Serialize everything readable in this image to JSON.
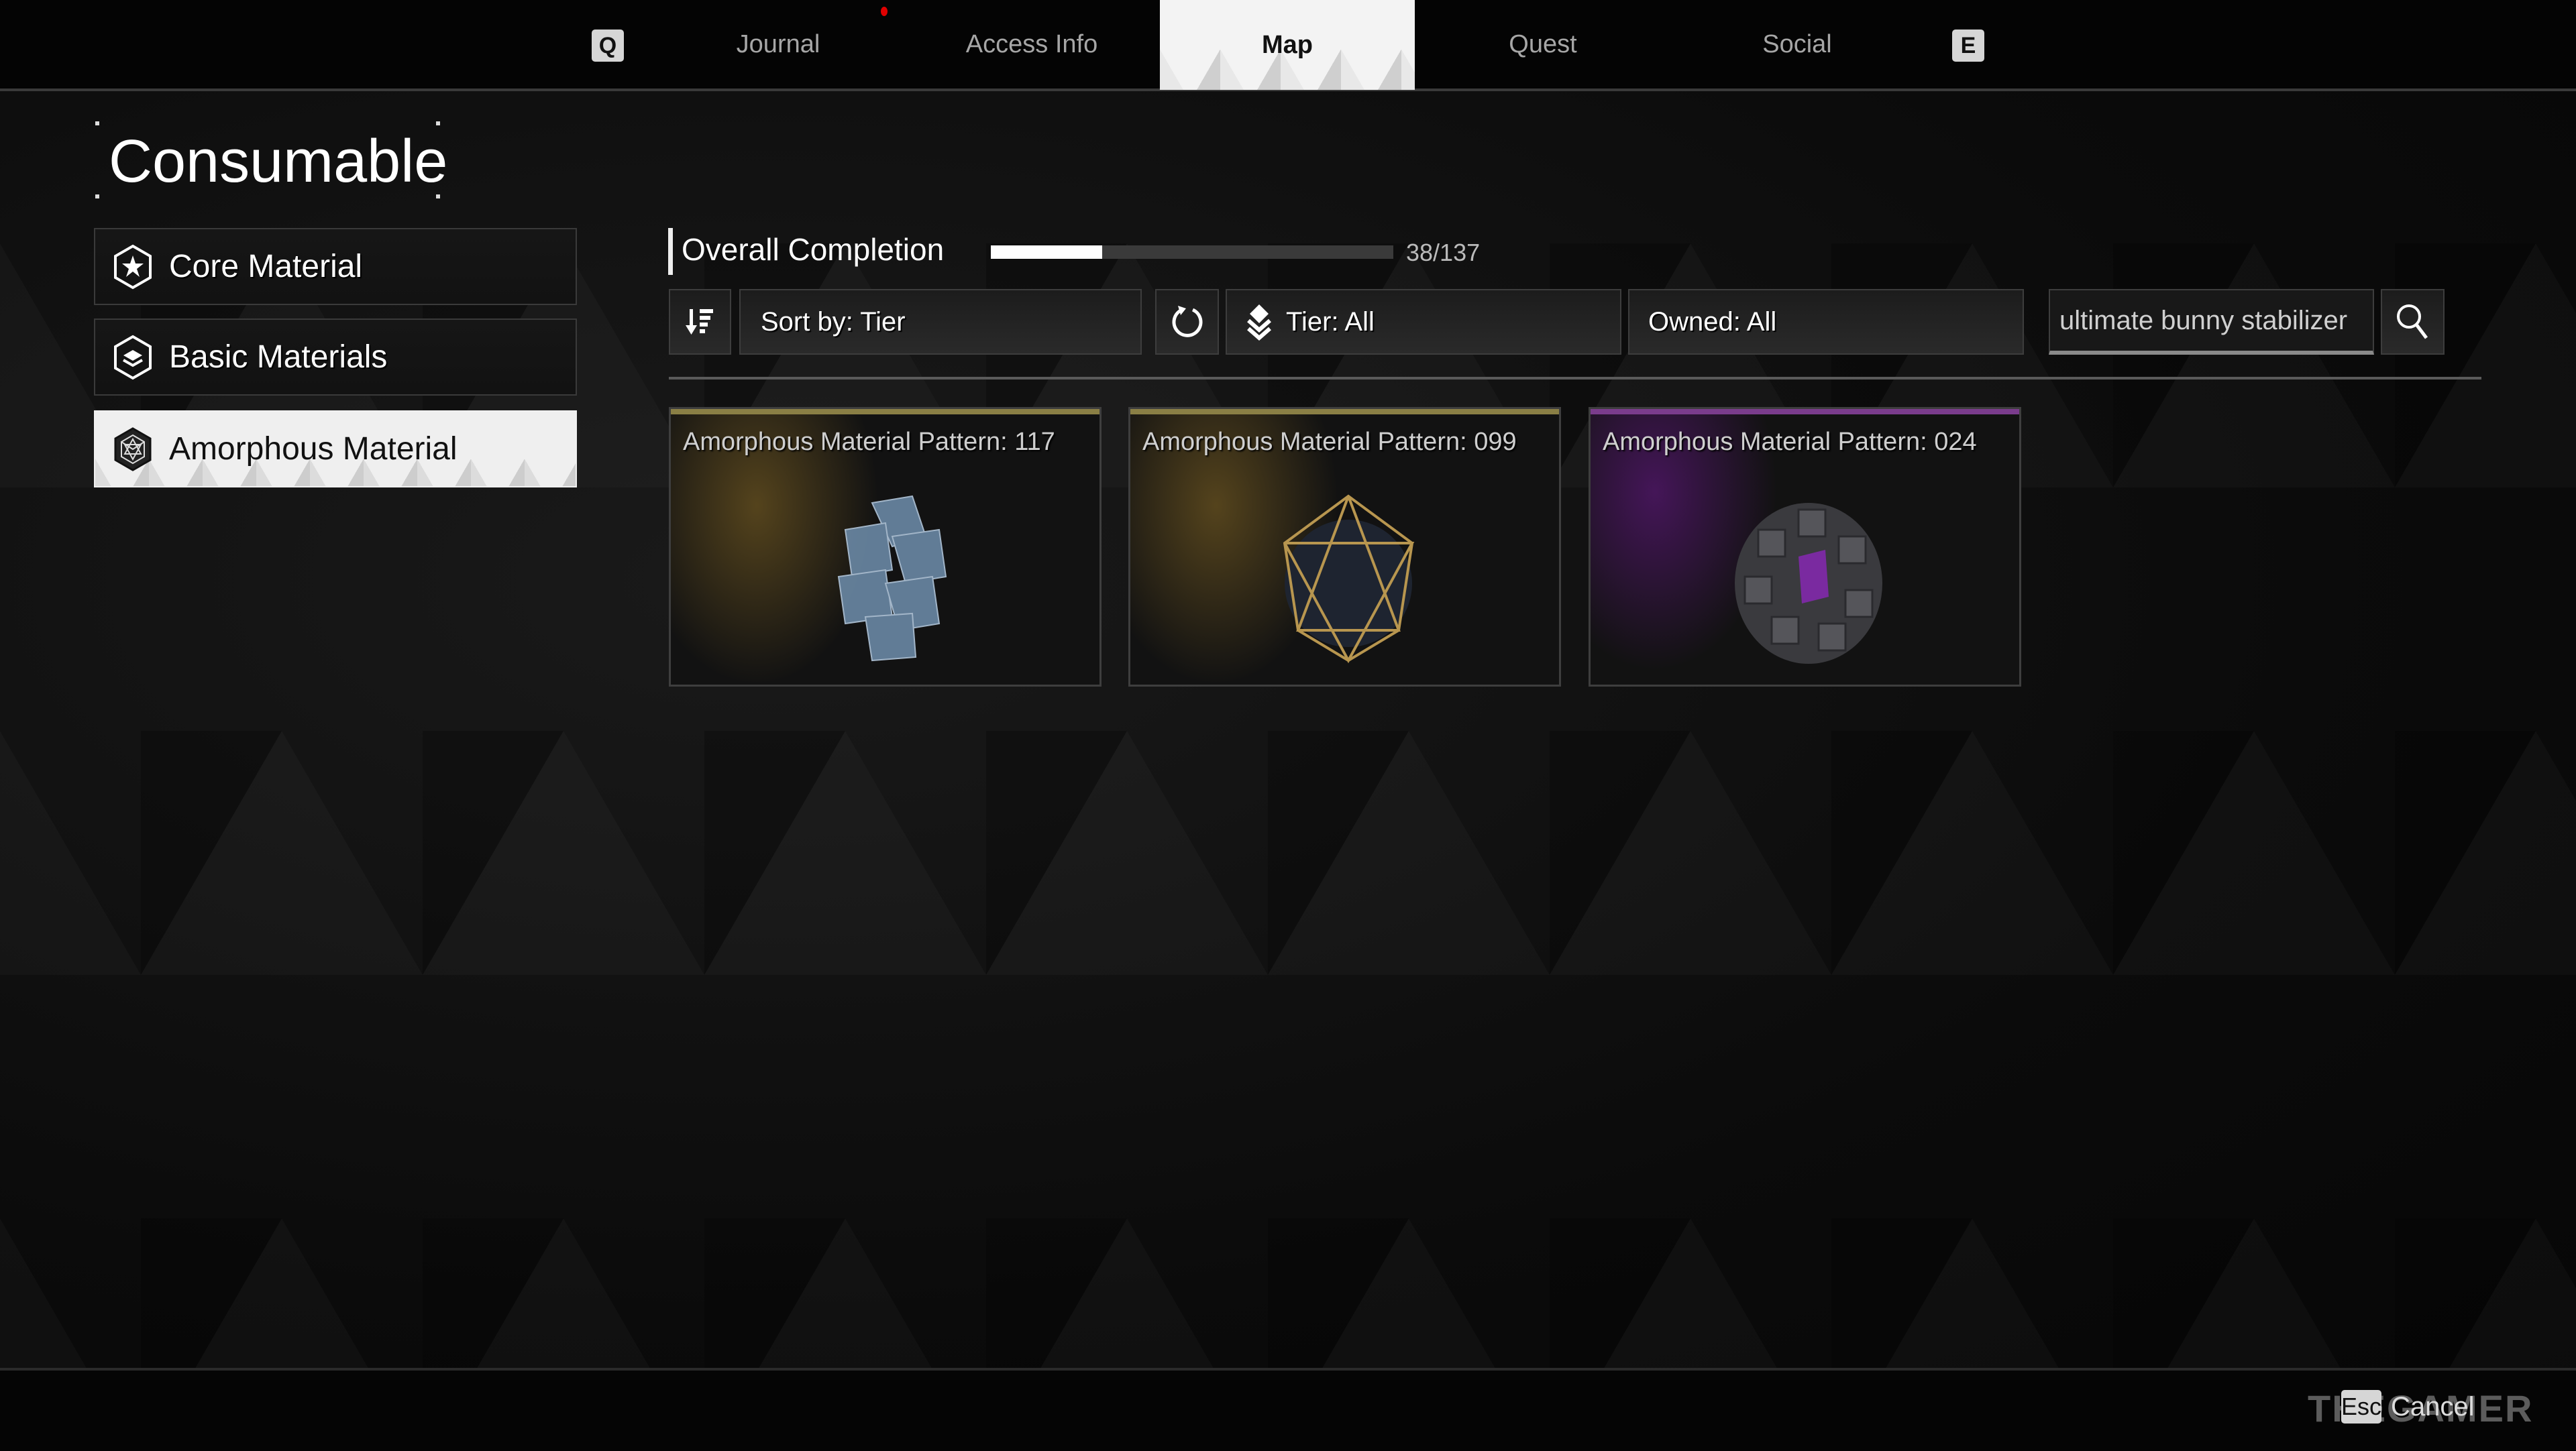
{
  "top_nav": {
    "prev_key": "Q",
    "next_key": "E",
    "tabs": [
      {
        "label": "Journal",
        "active": false,
        "notification": true
      },
      {
        "label": "Access Info",
        "active": false,
        "notification": false
      },
      {
        "label": "Map",
        "active": true,
        "notification": false
      },
      {
        "label": "Quest",
        "active": false,
        "notification": false
      },
      {
        "label": "Social",
        "active": false,
        "notification": false
      }
    ],
    "notification_color": "#e00000"
  },
  "page_title": "Consumable",
  "sidebar": {
    "items": [
      {
        "label": "Core Material",
        "icon": "hexagon-star-icon",
        "active": false
      },
      {
        "label": "Basic Materials",
        "icon": "hexagon-layers-icon",
        "active": false
      },
      {
        "label": "Amorphous Material",
        "icon": "hexagon-polyhedron-icon",
        "active": true
      }
    ]
  },
  "completion": {
    "label": "Overall Completion",
    "current": 38,
    "total": 137,
    "text": "38/137"
  },
  "filters": {
    "sort_order_icon": "sort-descending-icon",
    "sort_label": "Sort by: Tier",
    "reset_icon": "refresh-icon",
    "tier_icon": "tier-layers-icon",
    "tier_label": "Tier: All",
    "owned_label": "Owned: All",
    "search_value": "ultimate bunny stabilizer",
    "search_icon": "magnifier-icon"
  },
  "items": [
    {
      "name": "Amorphous Material Pattern: 117",
      "rarity_color": "#8a7f45",
      "glow_color": "#6b5420"
    },
    {
      "name": "Amorphous Material Pattern: 099",
      "rarity_color": "#8a7f45",
      "glow_color": "#6b5420"
    },
    {
      "name": "Amorphous Material Pattern: 024",
      "rarity_color": "#7a3c8c",
      "glow_color": "#4a1660"
    }
  ],
  "footer": {
    "cancel_key": "Esc",
    "cancel_label": "Cancel",
    "watermark": "THEGAMER"
  }
}
